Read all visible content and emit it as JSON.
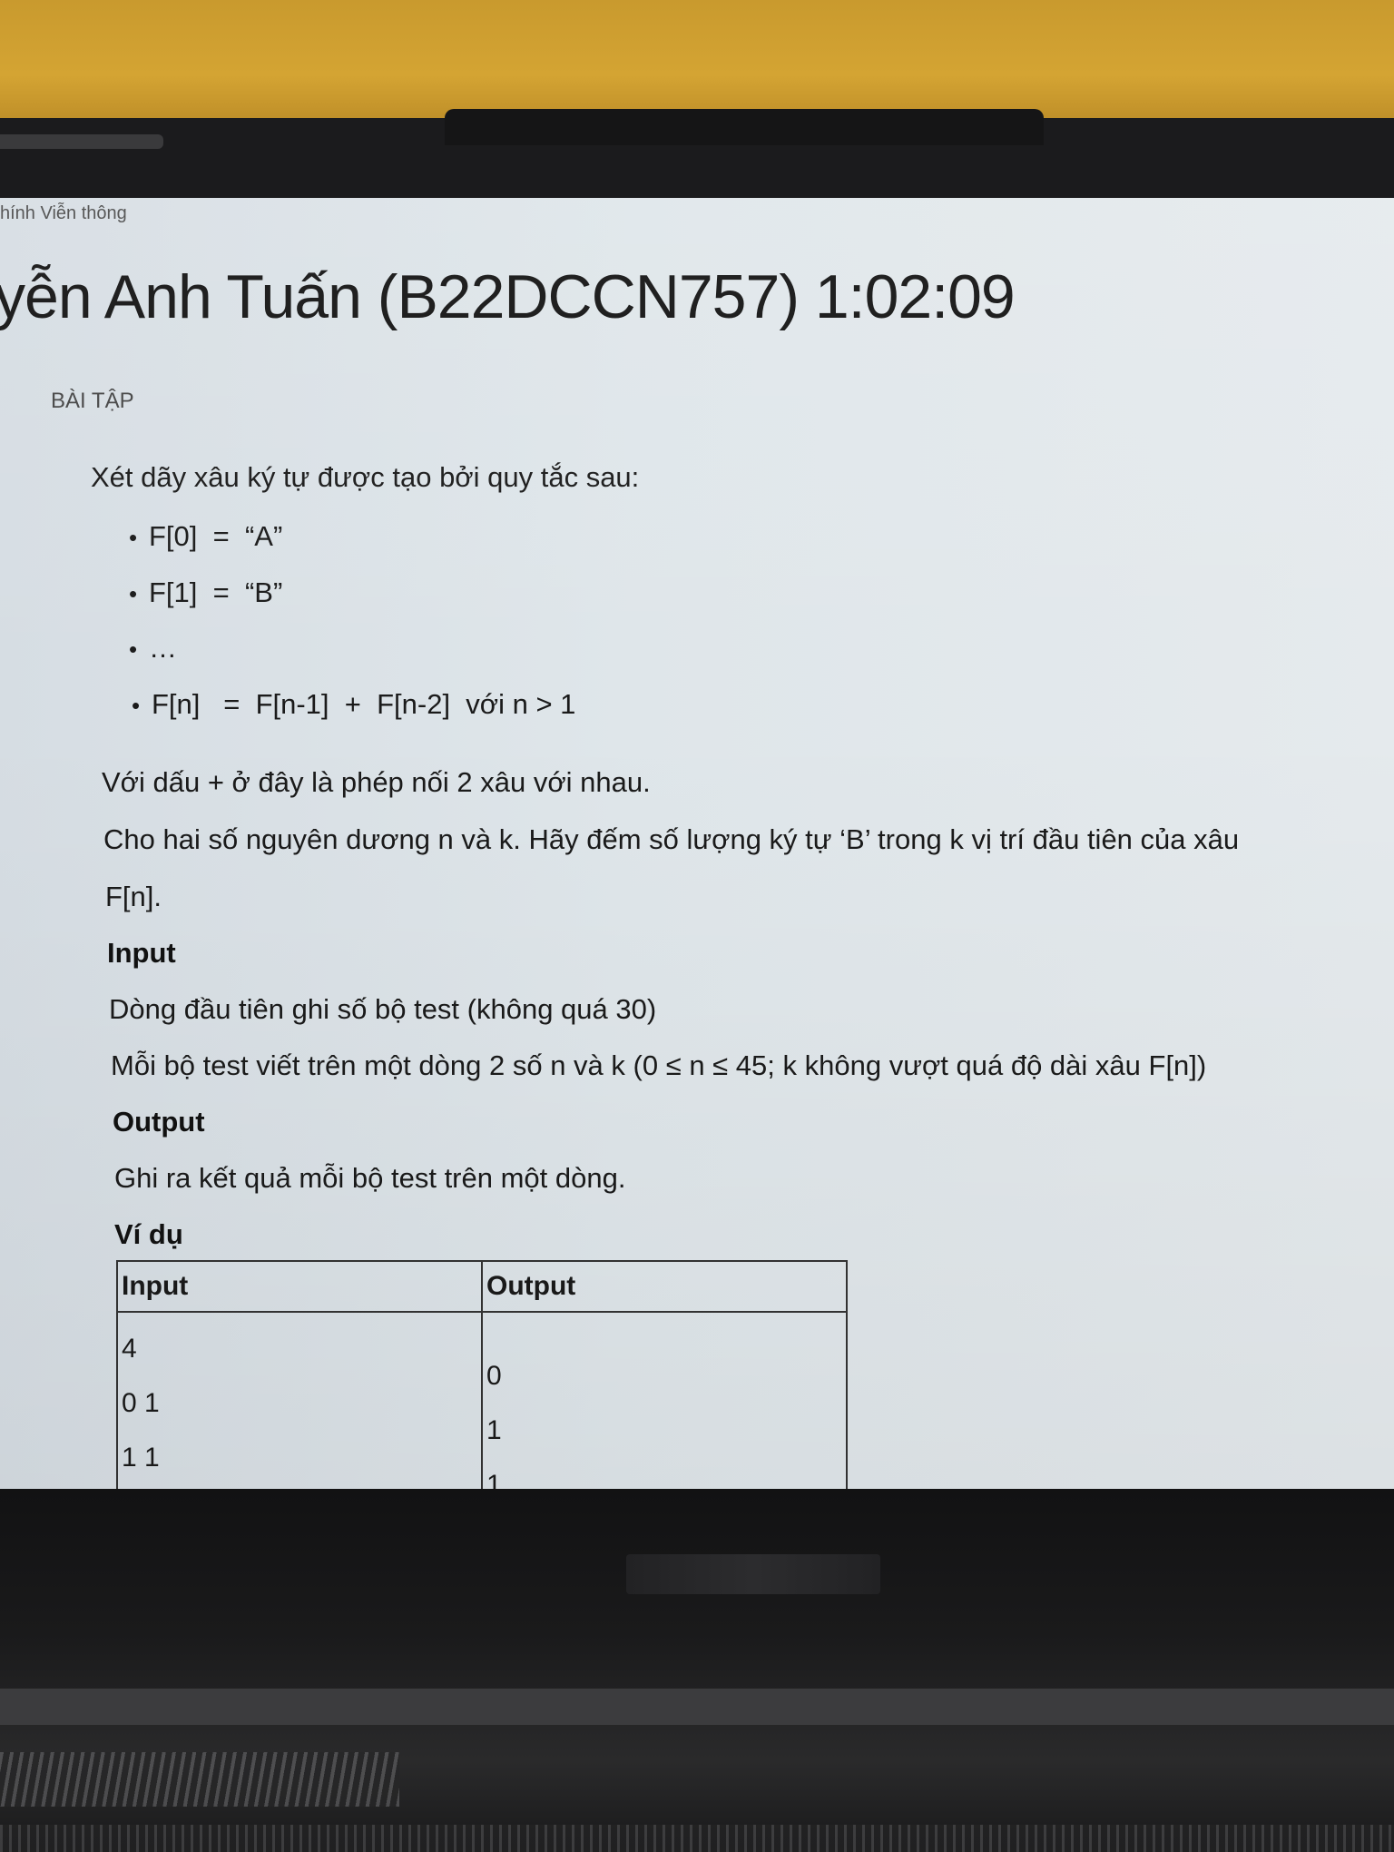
{
  "breadcrumb": "hính Viễn thông",
  "title": "yễn Anh Tuấn (B22DCCN757) 1:02:09",
  "section_label": "BÀI TẬP",
  "problem": {
    "intro": "Xét dãy xâu ký tự được tạo bởi quy tắc sau:",
    "rules": [
      "F[0]  =  “A”",
      "F[1]  =  “B”",
      "…",
      "F[n]   =  F[n-1]  +  F[n-2]  với n > 1"
    ],
    "note": "Với dấu + ở đây là phép nối 2 xâu với nhau.",
    "task_line1": "Cho hai số nguyên dương n và k. Hãy đếm số lượng ký tự ‘B’ trong k vị trí đầu tiên của xâu",
    "task_line2": "F[n].",
    "input_heading": "Input",
    "input_line1": "Dòng đầu tiên ghi số bộ test (không quá 30)",
    "input_line2": "Mỗi bộ test viết trên một dòng 2 số n và k (0 ≤ n ≤ 45; k không vượt quá độ dài xâu F[n])",
    "output_heading": "Output",
    "output_line": "Ghi ra kết quả mỗi bộ test trên một dòng.",
    "example_heading": "Ví dụ"
  },
  "example_table": {
    "headers": [
      "Input",
      "Output"
    ],
    "input_lines": [
      "4",
      "0 1",
      "1 1"
    ],
    "output_lines": [
      "0",
      "1",
      "1"
    ]
  }
}
